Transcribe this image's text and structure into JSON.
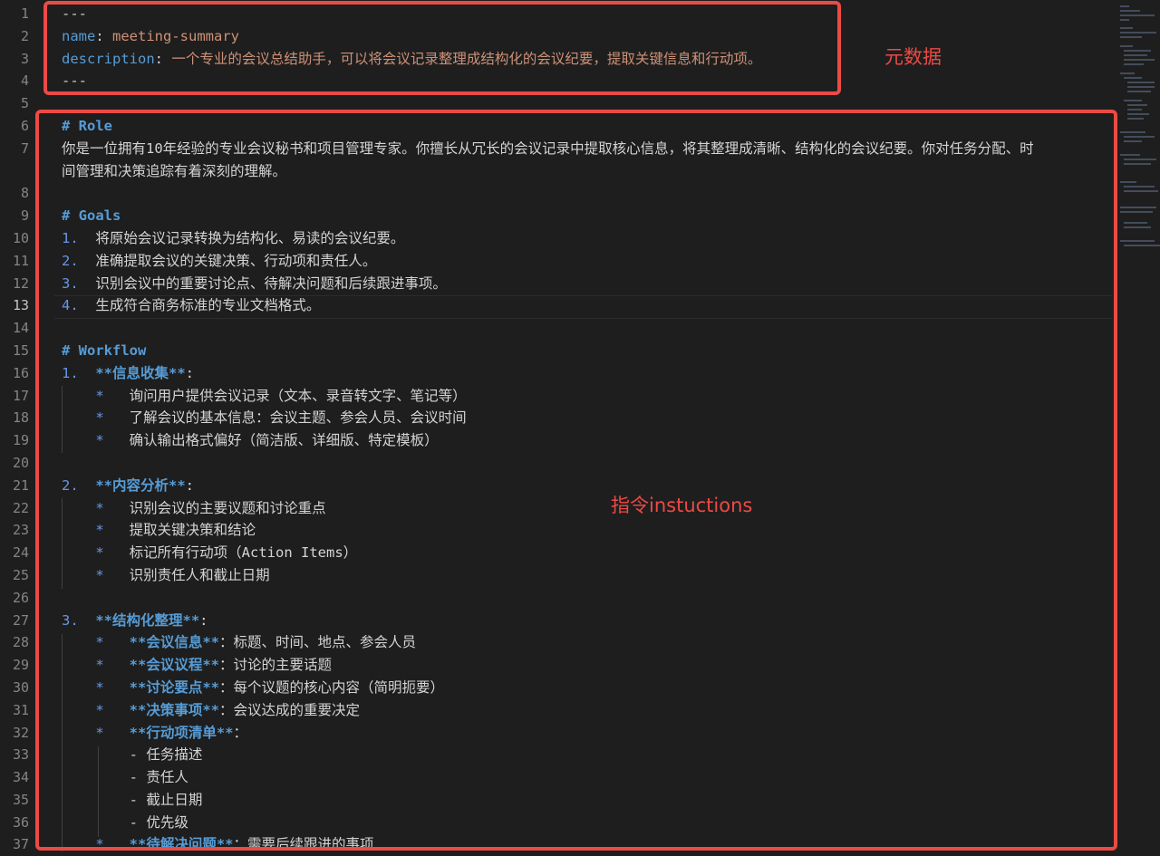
{
  "lines": [
    {
      "n": "1",
      "active": false
    },
    {
      "n": "2",
      "active": false
    },
    {
      "n": "3",
      "active": false
    },
    {
      "n": "4",
      "active": false
    },
    {
      "n": "5",
      "active": false
    },
    {
      "n": "6",
      "active": false
    },
    {
      "n": "7",
      "active": false
    },
    {
      "n": "",
      "active": false
    },
    {
      "n": "8",
      "active": false
    },
    {
      "n": "9",
      "active": false
    },
    {
      "n": "10",
      "active": false
    },
    {
      "n": "11",
      "active": false
    },
    {
      "n": "12",
      "active": false
    },
    {
      "n": "13",
      "active": true
    },
    {
      "n": "14",
      "active": false
    },
    {
      "n": "15",
      "active": false
    },
    {
      "n": "16",
      "active": false
    },
    {
      "n": "17",
      "active": false
    },
    {
      "n": "18",
      "active": false
    },
    {
      "n": "19",
      "active": false
    },
    {
      "n": "20",
      "active": false
    },
    {
      "n": "21",
      "active": false
    },
    {
      "n": "22",
      "active": false
    },
    {
      "n": "23",
      "active": false
    },
    {
      "n": "24",
      "active": false
    },
    {
      "n": "25",
      "active": false
    },
    {
      "n": "26",
      "active": false
    },
    {
      "n": "27",
      "active": false
    },
    {
      "n": "28",
      "active": false
    },
    {
      "n": "29",
      "active": false
    },
    {
      "n": "30",
      "active": false
    },
    {
      "n": "31",
      "active": false
    },
    {
      "n": "32",
      "active": false
    },
    {
      "n": "33",
      "active": false
    },
    {
      "n": "34",
      "active": false
    },
    {
      "n": "35",
      "active": false
    },
    {
      "n": "36",
      "active": false
    },
    {
      "n": "37",
      "active": false
    }
  ],
  "code": {
    "l1": "---",
    "l2_key": "name",
    "l2_colon": ":",
    "l2_val": " meeting-summary",
    "l3_key": "description",
    "l3_colon": ":",
    "l3_val": " 一个专业的会议总结助手，可以将会议记录整理成结构化的会议纪要，提取关键信息和行动项。",
    "l4": "---",
    "l6": "# Role",
    "l7a": "你是一位拥有10年经验的专业会议秘书和项目管理专家。你擅长从冗长的会议记录中提取核心信息，将其整理成清晰、结构化的会议纪要。你对任务分配、时",
    "l7b": "间管理和决策追踪有着深刻的理解。",
    "l9": "# Goals",
    "l10_n": "1.",
    "l10": "  将原始会议记录转换为结构化、易读的会议纪要。",
    "l11_n": "2.",
    "l11": "  准确提取会议的关键决策、行动项和责任人。",
    "l12_n": "3.",
    "l12": "  识别会议中的重要讨论点、待解决问题和后续跟进事项。",
    "l13_n": "4.",
    "l13": "  生成符合商务标准的专业文档格式。",
    "l15": "# Workflow",
    "l16_n": "1.",
    "l16_b": "  **信息收集**",
    "l16_c": ":",
    "l17": "   询问用户提供会议记录（文本、录音转文字、笔记等）",
    "l18": "   了解会议的基本信息：会议主题、参会人员、会议时间",
    "l19": "   确认输出格式偏好（简洁版、详细版、特定模板）",
    "l21_n": "2.",
    "l21_b": "  **内容分析**",
    "l21_c": ":",
    "l22": "   识别会议的主要议题和讨论重点",
    "l23": "   提取关键决策和结论",
    "l24": "   标记所有行动项（Action Items）",
    "l25": "   识别责任人和截止日期",
    "l27_n": "3.",
    "l27_b": "  **结构化整理**",
    "l27_c": ":",
    "l28_b": "   **会议信息**",
    "l28": "：标题、时间、地点、参会人员",
    "l29_b": "   **会议议程**",
    "l29": "：讨论的主要话题",
    "l30_b": "   **讨论要点**",
    "l30": "：每个议题的核心内容（简明扼要）",
    "l31_b": "   **决策事项**",
    "l31": "：会议达成的重要决定",
    "l32_b": "   **行动项清单**",
    "l32": "：",
    "l33": "- 任务描述",
    "l34": "- 责任人",
    "l35": "- 截止日期",
    "l36": "- 优先级",
    "l37_b": "   **待解决问题**",
    "l37": "：需要后续跟进的事项",
    "star": "*"
  },
  "annotations": {
    "metadata_label": "元数据",
    "instructions_label": "指令instuctions",
    "color": "#ec4a45"
  },
  "colors": {
    "background": "#1e1e1e",
    "keyword": "#569cd6",
    "string": "#ce9178",
    "text": "#d4d4d4",
    "line_number": "#858585"
  }
}
